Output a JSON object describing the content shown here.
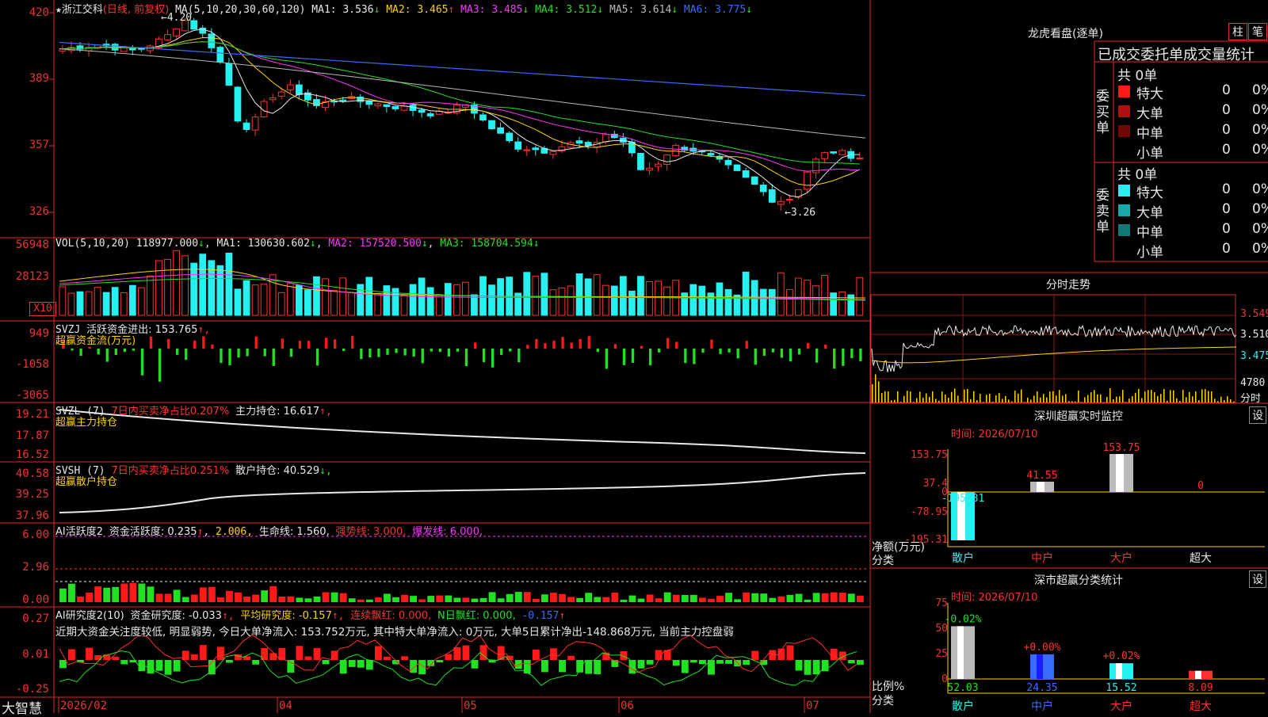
{
  "app": {
    "name": "大智慧"
  },
  "stock": {
    "name": "浙江交科",
    "mode": "(日线, 前复权)"
  },
  "price_axis": {
    "ticks": [
      "420",
      "389",
      "357",
      "326"
    ],
    "values": [
      420,
      389,
      357,
      326
    ]
  },
  "ma_bar": {
    "label": "MA(5,10,20,30,60,120)",
    "items": [
      {
        "name": "MA1",
        "value": "3.536",
        "arrow": "↓",
        "color": "#e8e8e8"
      },
      {
        "name": "MA2",
        "value": "3.465",
        "arrow": "↑",
        "color": "#ffd200"
      },
      {
        "name": "MA3",
        "value": "3.485",
        "arrow": "↓",
        "color": "#ff33ff"
      },
      {
        "name": "MA4",
        "value": "3.512",
        "arrow": "↓",
        "color": "#22e022"
      },
      {
        "name": "MA5",
        "value": "3.614",
        "arrow": "↓",
        "color": "#bbbbbb"
      },
      {
        "name": "MA6",
        "value": "3.775",
        "arrow": "↓",
        "color": "#3a6bff"
      }
    ]
  },
  "annotations": {
    "high": "←4.20",
    "low": "←3.26"
  },
  "vol_panel": {
    "label": "VOL(5,10,20)",
    "value": "118977.000",
    "arrow": "↓",
    "ma1": "MA1: 130630.602",
    "ma2": "MA2: 157520.500",
    "ma3": "MA3: 158704.594",
    "ticks": [
      "56948",
      "28123"
    ],
    "unit": "X10"
  },
  "svzj_panel": {
    "label": "SVZJ",
    "text1": "活跃资金进出: 153.765",
    "arrow": "↑,",
    "text2": "超赢资金流(万元)",
    "ticks": [
      "949",
      "-1058",
      "-3065"
    ]
  },
  "svzl_panel": {
    "label": "SVZL (7)",
    "text1": "7日内买卖净占比0.207%",
    "text2": "主力持仓: 16.617",
    "arrow": "↑,",
    "text3": "超赢主力持仓",
    "ticks": [
      "19.21",
      "17.87",
      "16.52"
    ]
  },
  "svsh_panel": {
    "label": "SVSH (7)",
    "text1": "7日内买卖净占比0.251%",
    "text2": "散户持仓: 40.529",
    "arrow": "↓,",
    "text3": "超赢散户持仓",
    "ticks": [
      "40.58",
      "39.25",
      "37.96"
    ]
  },
  "ai_active": {
    "label": "AI活跃度2",
    "text1": "资金活跃度: 0.235",
    "t1arrow": "↑",
    "v2": "2.006,",
    "text3": "生命线: 1.560,",
    "text4": "强势线: 3.000,",
    "text5": "爆发线: 6.000,",
    "ticks": [
      "6.00",
      "2.96",
      "0.00"
    ]
  },
  "ai_research": {
    "label": "AI研究度2(10)",
    "text1": "资金研究度: -0.033",
    "a1": "↑,",
    "text2": "平均研究度: -0.157",
    "a2": "↑,",
    "text3": "连续飘红: 0.000,",
    "text4": "N日飘红: 0.000,",
    "text5": "-0.157",
    "a5": "↑",
    "summary": "近期大资金关注度较低, 明显弱势, 今日大单净流入: 153.752万元, 其中特大单净流入: 0万元, 大单5日累计净出-148.868万元, 当前主力控盘弱",
    "ticks": [
      "0.27",
      "0.01",
      "-0.25"
    ]
  },
  "date_axis": {
    "labels": [
      "2026/02",
      "04",
      "05",
      "06",
      "07"
    ]
  },
  "longhu": {
    "title": "龙虎看盘(逐单)",
    "btn1": "柱",
    "btn2": "笔",
    "subtitle": "已成交委托单成交量统计",
    "buy": {
      "side": "委买单",
      "total": "共 0单",
      "rows": [
        {
          "label": "特大",
          "count": "0",
          "pct": "0%",
          "color": "#ff1a1a"
        },
        {
          "label": "大单",
          "count": "0",
          "pct": "0%",
          "color": "#b01010"
        },
        {
          "label": "中单",
          "count": "0",
          "pct": "0%",
          "color": "#700808"
        },
        {
          "label": "小单",
          "count": "0",
          "pct": "0%",
          "color": ""
        }
      ]
    },
    "sell": {
      "side": "委卖单",
      "total": "共 0单",
      "rows": [
        {
          "label": "特大",
          "count": "0",
          "pct": "0%",
          "color": "#26f0f0"
        },
        {
          "label": "大单",
          "count": "0",
          "pct": "0%",
          "color": "#1aa8a8"
        },
        {
          "label": "中单",
          "count": "0",
          "pct": "0%",
          "color": "#127878"
        },
        {
          "label": "小单",
          "count": "0",
          "pct": "0%",
          "color": ""
        }
      ]
    }
  },
  "intraday": {
    "title": "分时走势",
    "ticks": [
      "3.549",
      "3.510",
      "3.475",
      "4780",
      "分时"
    ]
  },
  "sz_monitor": {
    "title": "深圳超赢实时监控",
    "set": "设",
    "time": "时间: 2026/07/10",
    "ticks": [
      "153.75",
      "37.4",
      "0",
      "-78.95",
      "-195.31"
    ],
    "ylabel": "净额(万元)",
    "xlabel": "分类",
    "chart_data": {
      "type": "bar",
      "categories": [
        "散户",
        "中户",
        "大户",
        "超大"
      ],
      "values": [
        -195.31,
        41.55,
        153.75,
        0
      ],
      "labels": [
        "-195.31",
        "41.55",
        "153.75",
        "0"
      ]
    }
  },
  "sz_class": {
    "title": "深市超赢分类统计",
    "set": "设",
    "time": "时间: 2026/07/10",
    "ticks": [
      "75",
      "50",
      "25",
      "0"
    ],
    "ylabel": "比例%",
    "xlabel": "分类",
    "chart_data": {
      "type": "bar",
      "categories": [
        "散户",
        "中户",
        "大户",
        "超大"
      ],
      "values": [
        52.03,
        24.35,
        15.52,
        8.09
      ],
      "changes": [
        "-0.02%",
        "+0.00%",
        "+0.02%",
        ""
      ]
    }
  }
}
